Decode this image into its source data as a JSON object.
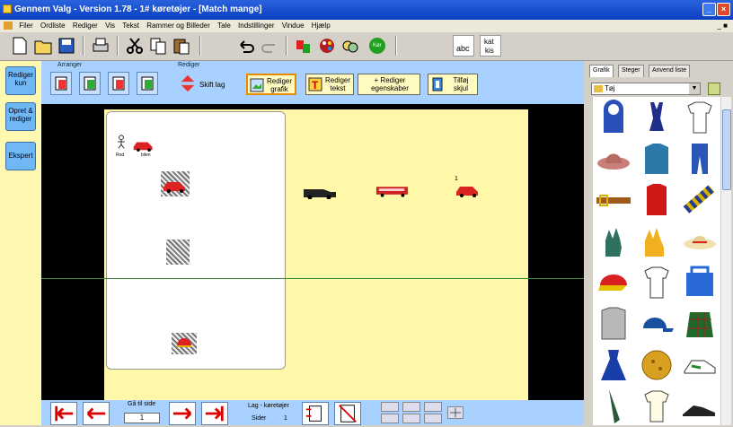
{
  "window": {
    "title": "Gennem Valg - Version 1.78 - 1# køretøjer - [Match mange]"
  },
  "menu": {
    "items": [
      "Filer",
      "Ordliste",
      "Rediger",
      "Vis",
      "Tekst",
      "Rammer og Billeder",
      "Tale",
      "Indstillinger",
      "Vindue",
      "Hjælp"
    ],
    "mdi_controls": "_ ■"
  },
  "toolbar": {
    "abc_label": "abc",
    "kat_label": "kat",
    "kis_label": "kis",
    "koer_label": "Kør"
  },
  "left_panel": {
    "buttons": [
      "Rediger kun",
      "Opret & rediger",
      "Ekspert"
    ]
  },
  "ribbon": {
    "arranger_label": "Arranger",
    "rediger_label": "Rediger",
    "skift_lag": "Skift lag",
    "btn_grafik": "Rediger grafik",
    "btn_tekst": "Rediger tekst",
    "btn_egenskaber": "+ Rediger egenskaber",
    "btn_tilfoej": "Tilføj skjul"
  },
  "stage": {
    "top_labels": [
      "Rod",
      "bilen"
    ],
    "number_label": "1"
  },
  "bottom": {
    "gaa_til_side": "Gå til side",
    "page_number": "1",
    "lag_label": "Lag - køretøjer",
    "sider_label": "Sider",
    "sider_count": "1"
  },
  "right_panel": {
    "tabs": [
      "Grafik",
      "Steger",
      "Anvend liste"
    ],
    "dropdown_value": "Tøj"
  }
}
